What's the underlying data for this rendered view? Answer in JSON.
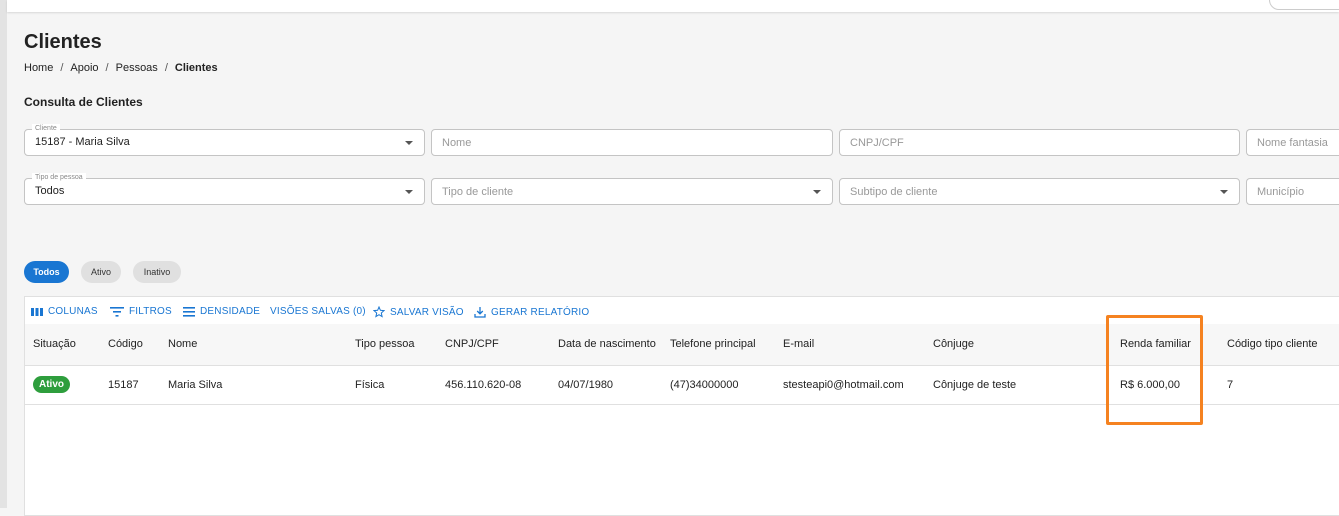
{
  "page": {
    "title": "Clientes",
    "breadcrumb": [
      "Home",
      "Apoio",
      "Pessoas",
      "Clientes"
    ],
    "section_title": "Consulta de Clientes"
  },
  "filters": {
    "cliente": {
      "label": "Cliente",
      "value": "15187 - Maria Silva"
    },
    "nome": {
      "placeholder": "Nome"
    },
    "cnpj_cpf": {
      "placeholder": "CNPJ/CPF"
    },
    "nome_fantasia": {
      "placeholder": "Nome fantasia"
    },
    "tipo_pessoa": {
      "label": "Tipo de pessoa",
      "value": "Todos"
    },
    "tipo_cliente": {
      "placeholder": "Tipo de cliente"
    },
    "subtipo_cliente": {
      "placeholder": "Subtipo de cliente"
    },
    "municipio": {
      "placeholder": "Município"
    }
  },
  "chips": [
    {
      "label": "Todos",
      "selected": true
    },
    {
      "label": "Ativo",
      "selected": false
    },
    {
      "label": "Inativo",
      "selected": false
    }
  ],
  "toolbar": {
    "colunas": "COLUNAS",
    "filtros": "FILTROS",
    "densidade": "DENSIDADE",
    "visoes_salvas": "VISÕES SALVAS (0)",
    "salvar_visao": "SALVAR VISÃO",
    "gerar_relatorio": "GERAR RELATÓRIO"
  },
  "table": {
    "columns": [
      "Situação",
      "Código",
      "Nome",
      "Tipo pessoa",
      "CNPJ/CPF",
      "Data de nascimento",
      "Telefone principal",
      "E-mail",
      "Cônjuge",
      "Renda familiar",
      "Código tipo cliente"
    ],
    "rows": [
      {
        "situacao": "Ativo",
        "codigo": "15187",
        "nome": "Maria Silva",
        "tipo_pessoa": "Física",
        "cnpj_cpf": "456.110.620-08",
        "data_nascimento": "04/07/1980",
        "telefone": "(47)34000000",
        "email": "stesteapi0@hotmail.com",
        "conjuge": "Cônjuge de teste",
        "renda_familiar": "R$ 6.000,00",
        "codigo_tipo_cliente": "7"
      }
    ]
  },
  "colors": {
    "primary": "#1976d2",
    "status_active": "#2e9e3d",
    "highlight": "#f58220"
  }
}
